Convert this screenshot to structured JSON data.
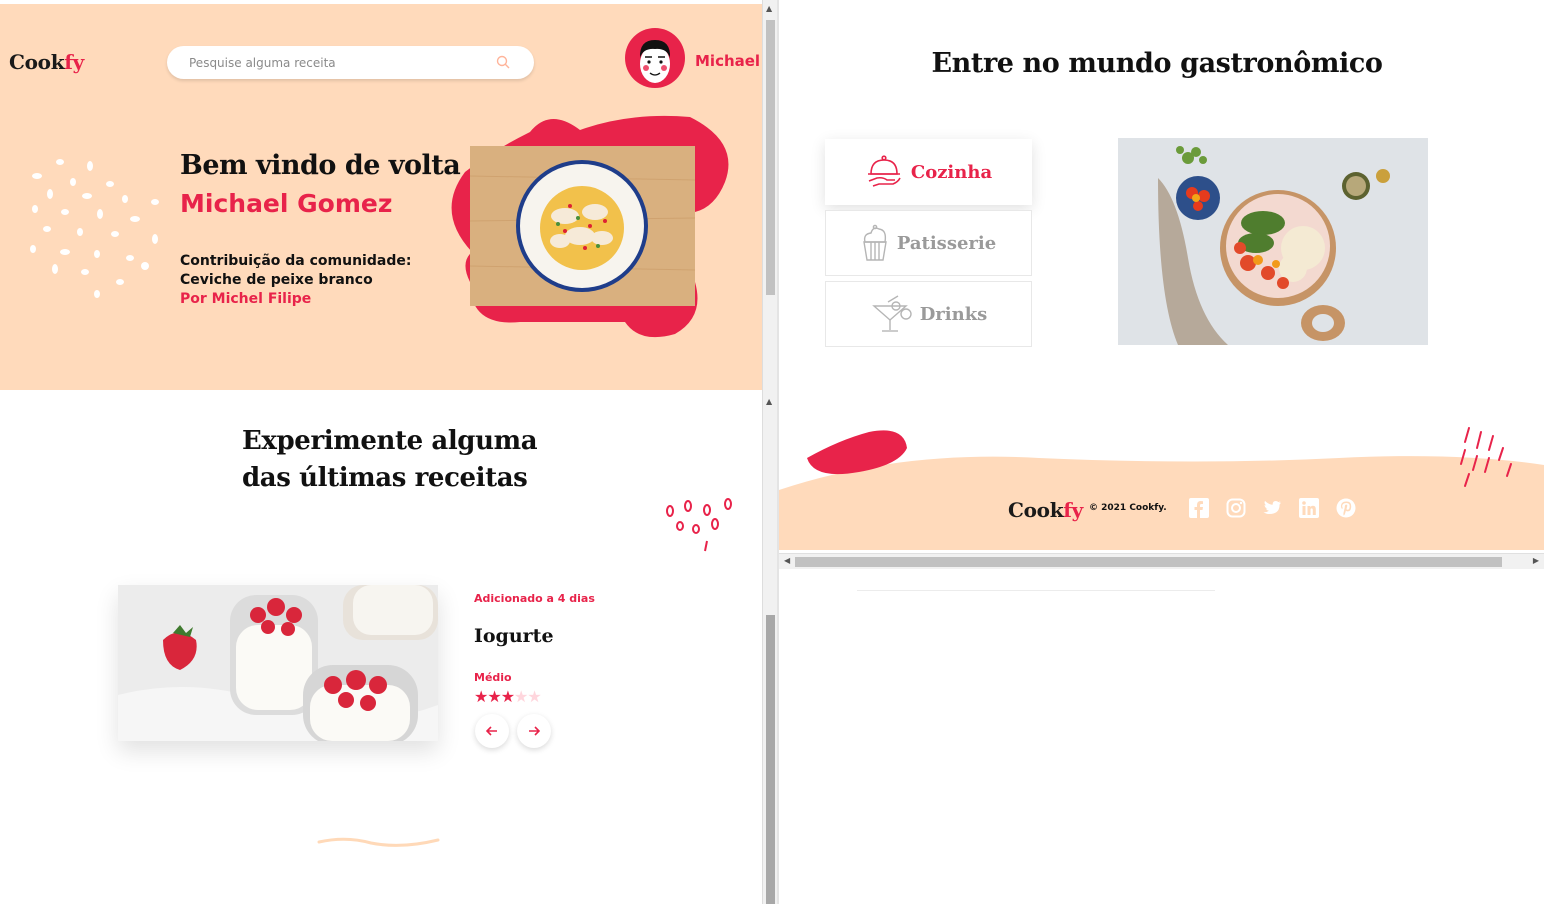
{
  "brand": {
    "name_part1": "Cook",
    "name_part2": "fy"
  },
  "search": {
    "placeholder": "Pesquise alguma receita"
  },
  "user": {
    "first_name": "Michael"
  },
  "hero": {
    "greeting": "Bem vindo de volta",
    "full_name": "Michael Gomez",
    "contribution_label": "Contribuição da comunidade:",
    "dish": "Ceviche de peixe branco",
    "author": "Por Michel Filipe"
  },
  "latest": {
    "title_line1": "Experimente alguma",
    "title_line2": "das últimas receitas",
    "recipe": {
      "added": "Adicionado a 4 dias",
      "name": "Iogurte",
      "difficulty": "Médio",
      "rating": 3,
      "rating_max": 5
    }
  },
  "world": {
    "title": "Entre no mundo gastronômico",
    "categories": [
      {
        "label": "Cozinha",
        "icon": "cloche-icon",
        "active": true
      },
      {
        "label": "Patisserie",
        "icon": "cupcake-icon",
        "active": false
      },
      {
        "label": "Drinks",
        "icon": "cocktail-icon",
        "active": false
      }
    ]
  },
  "footer": {
    "copyright": "© 2021 Cookfy.",
    "social": [
      "facebook-icon",
      "instagram-icon",
      "twitter-icon",
      "linkedin-icon",
      "pinterest-icon"
    ]
  },
  "colors": {
    "accent": "#e8234a",
    "peach": "#ffdabb",
    "text": "#111111",
    "muted": "#9a9a9a"
  }
}
